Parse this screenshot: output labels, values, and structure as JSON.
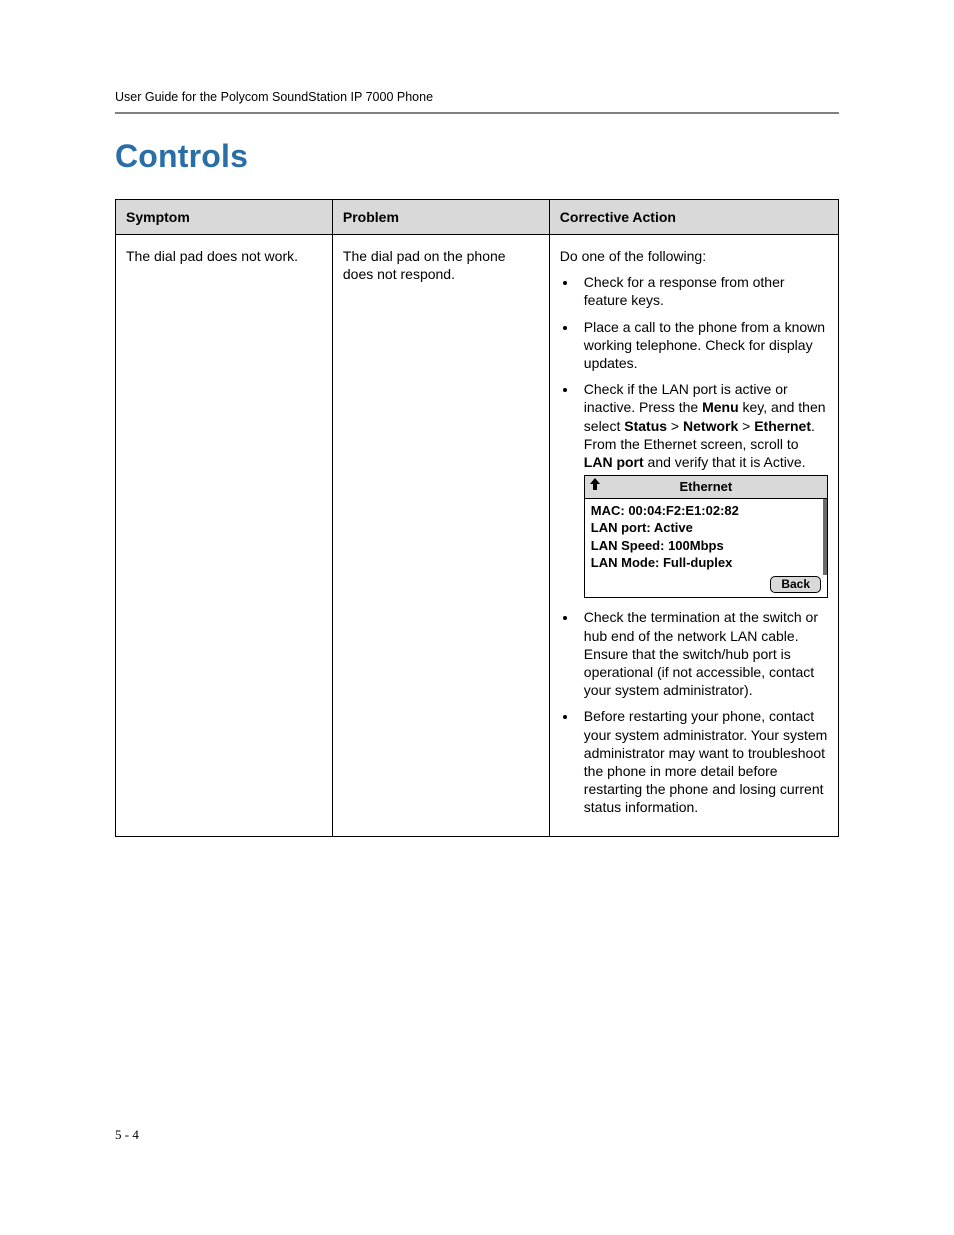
{
  "header": "User Guide for the Polycom SoundStation IP 7000 Phone",
  "section_title": "Controls",
  "table": {
    "headers": {
      "symptom": "Symptom",
      "problem": "Problem",
      "action": "Corrective Action"
    },
    "row": {
      "symptom": "The dial pad does not work.",
      "problem": "The dial pad on the phone does not respond.",
      "action_intro": "Do one of the following:",
      "bullets_before": [
        "Check for a response from other feature keys.",
        "Place a call to the phone from a known working telephone. Check for display updates."
      ],
      "bullet_lan": {
        "pre": "Check if the LAN port is active or inactive. Press the ",
        "menu_bold": "Menu",
        "mid1": " key, and then select ",
        "status_bold": "Status",
        "gt1": " > ",
        "network_bold": "Network",
        "gt2": " > ",
        "ethernet_bold": "Ethernet",
        "mid2": ". From the Ethernet screen, scroll to ",
        "lanport_bold": "LAN port",
        "post": " and verify that it is Active."
      },
      "bullets_after": [
        "Check the termination at the switch or hub end of the network LAN cable. Ensure that the switch/hub port is operational (if not accessible, contact your system administrator).",
        "Before restarting your phone, contact your system administrator. Your system administrator may want to troubleshoot the phone in more detail before restarting the phone and losing current status information."
      ]
    }
  },
  "phone_screen": {
    "title": "Ethernet",
    "lines": [
      "MAC: 00:04:F2:E1:02:82",
      "LAN port: Active",
      "LAN Speed: 100Mbps",
      "LAN Mode: Full-duplex"
    ],
    "back_label": "Back"
  },
  "page_number": "5 - 4"
}
